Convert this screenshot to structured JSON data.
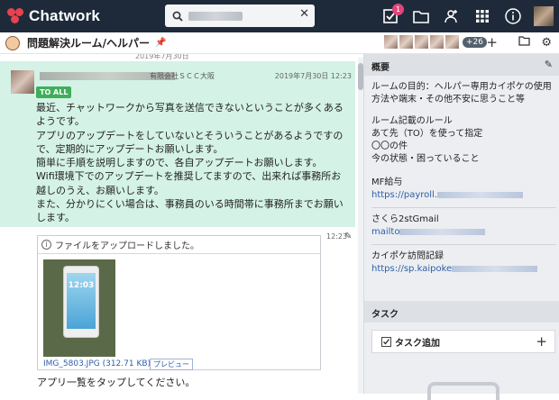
{
  "app": {
    "name": "Chatwork",
    "notification_count": "1"
  },
  "room": {
    "title": "問題解決ルーム/ヘルパー",
    "member_more": "+26"
  },
  "chat": {
    "date_separator": "2019年7月30日",
    "message": {
      "org": "有限会社ＳＣＣ大阪",
      "time": "2019年7月30日 12:23",
      "tag": "TO ALL",
      "lines": [
        "最近、チャットワークから写真を送信できないということが多くある",
        "ようです。",
        "アプリのアップデートをしていないとそういうことがあるようですの",
        "で、定期的にアップデートお願いします。",
        "簡単に手順を説明しますので、各自アップデートお願いします。",
        "Wifi環境下でのアップデートを推奨してますので、出来れば事務所お",
        "越しのうえ、お願いします。",
        "また、分かりにくい場合は、事務員のいる時間帯に事務所までお願い",
        "します。"
      ]
    },
    "reply_time": "12:23",
    "file": {
      "header": "ファイルをアップロードしました。",
      "name": "IMG_5803.JPG (312.71 KB)",
      "preview_label": "プレビュー",
      "thumb_clock": "12:03"
    },
    "next_line": "アプリ一覧をタップしてください。"
  },
  "overview": {
    "header": "概要",
    "purpose": [
      "ルームの目的：ヘルパー専用カイポケの使用",
      "方法や端末・その他不安に思うこと等"
    ],
    "rules": [
      "ルーム記載のルール",
      "あて先（TO）を使って指定",
      "〇〇の件",
      "今の状態・困っていること"
    ],
    "mf_label": "MF給与",
    "mf_link": "https://payroll.",
    "gmail_label": "さくら2stGmail",
    "gmail_link": "mailto",
    "kaipoke_label": "カイポケ訪問記録",
    "kaipoke_link": "https://sp.kaipoke"
  },
  "tasks": {
    "header": "タスク",
    "add_label": "タスク追加"
  }
}
